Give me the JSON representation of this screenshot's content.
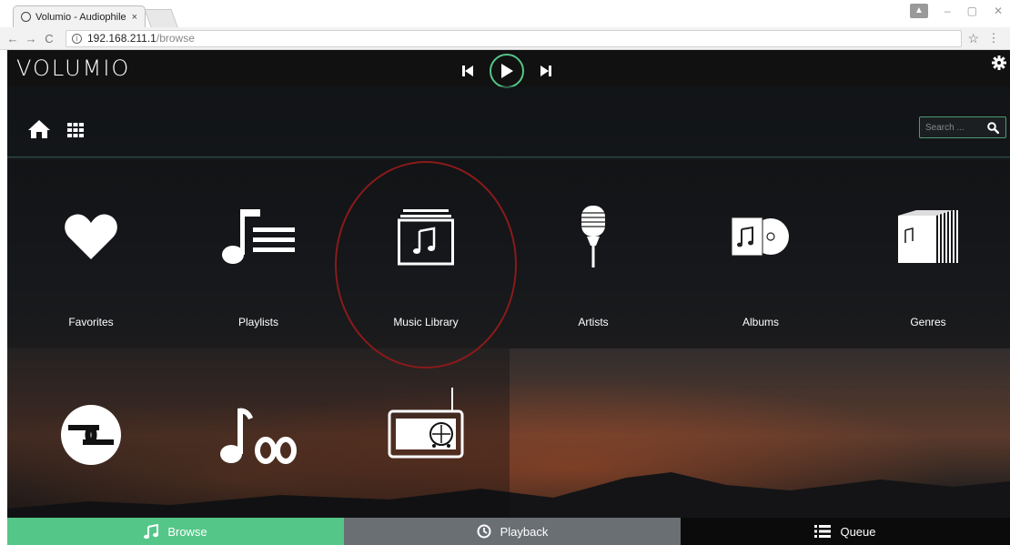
{
  "browser": {
    "tab_title": "Volumio - Audiophile I",
    "tab_close": "×",
    "url_host": "192.168.211.1",
    "url_path": "/browse",
    "user_badge": "▲",
    "minimize": "–",
    "maximize": "▢",
    "close": "✕",
    "back": "←",
    "forward": "→",
    "reload": "C",
    "bookmark": "☆",
    "menu": "⋮"
  },
  "header": {
    "logo": "VOLUMIO",
    "prev_icon": "skip-back-icon",
    "play_icon": "play-icon",
    "next_icon": "skip-forward-icon",
    "settings_icon": "gear-icon"
  },
  "toolbar": {
    "home_icon": "home-icon",
    "grid_icon": "grid-icon",
    "search_placeholder": "Search ...",
    "search_icon": "search-icon"
  },
  "tiles": [
    {
      "label": "Favorites",
      "icon": "heart-icon"
    },
    {
      "label": "Playlists",
      "icon": "playlist-icon"
    },
    {
      "label": "Music Library",
      "icon": "music-library-icon"
    },
    {
      "label": "Artists",
      "icon": "microphone-icon"
    },
    {
      "label": "Albums",
      "icon": "album-icon"
    },
    {
      "label": "Genres",
      "icon": "genres-icon"
    },
    {
      "label": "",
      "icon": "tidal-link-icon"
    },
    {
      "label": "",
      "icon": "last-fm-icon"
    },
    {
      "label": "",
      "icon": "radio-icon"
    }
  ],
  "bottom_nav": {
    "browse": "Browse",
    "playback": "Playback",
    "queue": "Queue"
  },
  "colors": {
    "accent": "#54c688",
    "playback_bg": "#6a6f74",
    "highlight_ring": "#8b1a1a"
  }
}
